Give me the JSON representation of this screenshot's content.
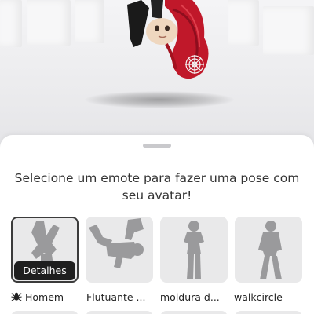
{
  "scene": {
    "description_icon": "avatar-3d-preview"
  },
  "sheet": {
    "prompt": "Selecione um emote para fazer uma pose com seu avatar!",
    "details_label": "Detalhes"
  },
  "emotes": [
    {
      "name": "Homem",
      "icon": "spider-icon",
      "selected": true
    },
    {
      "name": "Flutuante ...",
      "icon": "",
      "selected": false
    },
    {
      "name": "moldura d...",
      "icon": "",
      "selected": false
    },
    {
      "name": "walkcircle",
      "icon": "",
      "selected": false
    }
  ],
  "colors": {
    "avatar_hair": "#c0182a",
    "card_bg": "#e9e9ea",
    "figure": "#9a9a9c",
    "button_bg": "#1f1f1f"
  }
}
